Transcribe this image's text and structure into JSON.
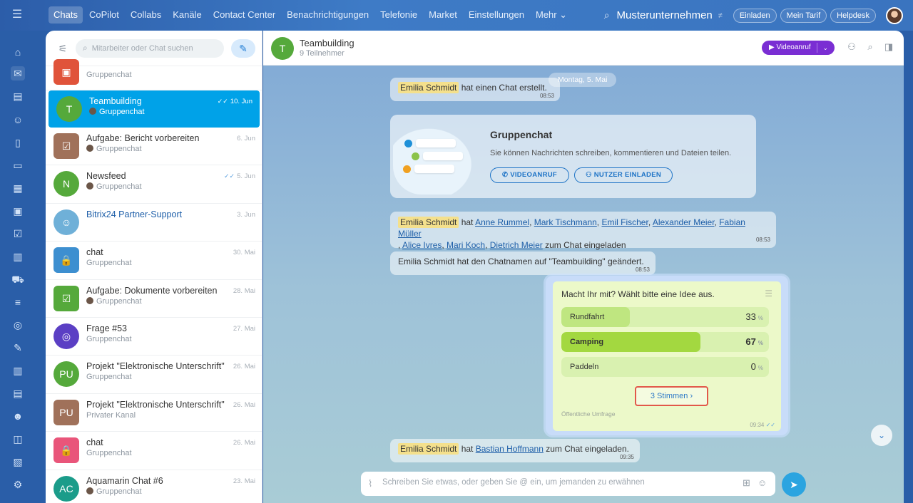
{
  "topbar": {
    "nav": [
      "Chats",
      "CoPilot",
      "Collabs",
      "Kanäle",
      "Contact Center",
      "Benachrichtigungen",
      "Telefonie",
      "Market",
      "Einstellungen",
      "Mehr ⌄"
    ],
    "company": "Musterunternehmen",
    "invite": "Einladen",
    "tariff": "Mein Tarif",
    "helpdesk": "Helpdesk"
  },
  "sidebar": {
    "search_placeholder": "Mitarbeiter oder Chat suchen",
    "chats": [
      {
        "title": "",
        "sub": "Gruppenchat",
        "date": "",
        "color": "#e0533a",
        "initial": "",
        "shape": "sq",
        "icon": "▣"
      },
      {
        "title": "Teambuilding",
        "sub": "Gruppenchat",
        "date": "10. Jun",
        "color": "#55a93b",
        "initial": "T",
        "shape": "round",
        "icon": "",
        "active": true,
        "ticks": "✓✓",
        "mini": true
      },
      {
        "title": "Aufgabe: Bericht vorbereiten",
        "sub": "Gruppenchat",
        "date": "6. Jun",
        "color": "#a0715a",
        "initial": "",
        "shape": "sq",
        "icon": "☑",
        "mini": true
      },
      {
        "title": "Newsfeed",
        "sub": "Gruppenchat",
        "date": "5. Jun",
        "color": "#55a93b",
        "initial": "N",
        "shape": "round",
        "icon": "",
        "ticks": "✓✓",
        "mini": true
      },
      {
        "title": "Bitrix24 Partner-Support",
        "sub": "",
        "date": "3. Jun",
        "color": "#6fb0d8",
        "initial": "",
        "shape": "round",
        "icon": "☺"
      },
      {
        "title": "chat",
        "sub": "Gruppenchat",
        "date": "30. Mai",
        "color": "#3d8fd0",
        "initial": "",
        "shape": "sq",
        "icon": "🔒"
      },
      {
        "title": "Aufgabe: Dokumente vorbereiten",
        "sub": "Gruppenchat",
        "date": "28. Mai",
        "color": "#55a93b",
        "initial": "",
        "shape": "sq",
        "icon": "☑",
        "mini": true
      },
      {
        "title": "Frage #53",
        "sub": "Gruppenchat",
        "date": "27. Mai",
        "color": "#5b3fc4",
        "initial": "",
        "shape": "round",
        "icon": "◎"
      },
      {
        "title": "Projekt \"Elektronische Unterschrift\"",
        "sub": "Gruppenchat",
        "date": "26. Mai",
        "color": "#55a93b",
        "initial": "PU",
        "shape": "round",
        "icon": ""
      },
      {
        "title": "Projekt \"Elektronische Unterschrift\"",
        "sub": "Privater Kanal",
        "date": "26. Mai",
        "color": "#a0715a",
        "initial": "PU",
        "shape": "sq",
        "icon": ""
      },
      {
        "title": "chat",
        "sub": "Gruppenchat",
        "date": "26. Mai",
        "color": "#e9557a",
        "initial": "",
        "shape": "sq",
        "icon": "🔒"
      },
      {
        "title": "Aquamarin Chat #6",
        "sub": "Gruppenchat",
        "date": "23. Mai",
        "color": "#1b9c8a",
        "initial": "AC",
        "shape": "round",
        "icon": "",
        "mini": true
      }
    ]
  },
  "chat": {
    "title": "Teambuilding",
    "subtitle": "9 Teilnehmer",
    "video_label": "Videoanruf",
    "date_divider": "Montag, 5. Mai",
    "m1": {
      "author": "Emilia Schmidt",
      "text": "hat einen Chat erstellt.",
      "time": "08:53"
    },
    "card": {
      "title": "Gruppenchat",
      "text": "Sie können Nachrichten schreiben, kommentieren und Dateien teilen.",
      "btn_video": "VIDEOANRUF",
      "btn_invite": "NUTZER EINLADEN"
    },
    "m2": {
      "author": "Emilia Schmidt",
      "text1": "hat",
      "names": [
        "Anne Rummel",
        "Mark Tischmann",
        "Emil Fischer",
        "Alexander Meier",
        "Fabian Müller",
        "Alice Ivres",
        "Mari Koch",
        "Dietrich Meier"
      ],
      "text2": "zum Chat eingeladen",
      "time": "08:53"
    },
    "m3": {
      "text": "Emilia Schmidt hat den Chatnamen auf \"Teambuilding\" geändert.",
      "time": "08:53"
    },
    "poll": {
      "question": "Macht Ihr mit? Wählt bitte eine Idee aus.",
      "options": [
        {
          "label": "Rundfahrt",
          "pct": 33
        },
        {
          "label": "Camping",
          "pct": 67
        },
        {
          "label": "Paddeln",
          "pct": 0
        }
      ],
      "pct_sign": "%",
      "votes": "3 Stimmen",
      "footer": "Öffentliche Umfrage",
      "time": "09:34"
    },
    "m4": {
      "author": "Emilia Schmidt",
      "text1": "hat",
      "name": "Bastian Hoffmann",
      "text2": "zum Chat eingeladen.",
      "time": "09:35"
    },
    "composer_placeholder": "Schreiben Sie etwas, oder geben Sie @ ein, um jemanden zu erwähnen"
  }
}
